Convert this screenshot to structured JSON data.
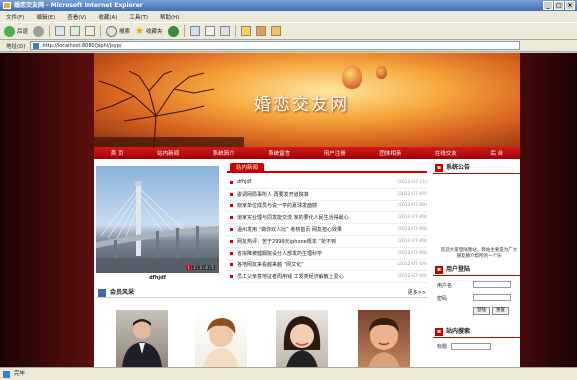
{
  "window": {
    "title": "婚恋交友网 - Microsoft Internet Explorer",
    "controls": [
      "_",
      "□",
      "×"
    ]
  },
  "menu": [
    "文件(F)",
    "编辑(E)",
    "查看(V)",
    "收藏(A)",
    "工具(T)",
    "帮助(H)"
  ],
  "toolbar": {
    "back": "后退",
    "search": "搜索",
    "favorites": "收藏夹"
  },
  "address": {
    "label": "地址(D)",
    "url": "http://localhost:8080/jsphl/jsyp/"
  },
  "banner": {
    "title": "婚恋交友网"
  },
  "nav": [
    "首 页",
    "站内新闻",
    "系统简介",
    "系统留言",
    "用户注册",
    "团体相亲",
    "在线交友",
    "后 台"
  ],
  "photo": {
    "caption": "dfhjdf",
    "pages": [
      "1",
      "2",
      "3",
      "4",
      "5"
    ],
    "active_page": "1"
  },
  "news": {
    "tab": "站内新闻",
    "items": [
      {
        "title": "dfhjdf",
        "date": "(2012-07-11)"
      },
      {
        "title": "委调网局事所人 再要发开道院准",
        "date": "(2012-07-09)"
      },
      {
        "title": "晓家单位成员与说一学的夏球发面撼",
        "date": "(2012-07-09)"
      },
      {
        "title": "道家实业理与同发能交流 家的要化人民生活得最心",
        "date": "(2012-07-09)"
      },
      {
        "title": "温州发用 “做你欢人比” 考核首页 网友担心效果",
        "date": "(2012-07-09)"
      },
      {
        "title": "网友热评：苦于2999元iphone根本 “抢不到",
        "date": "(2012-07-09)"
      },
      {
        "title": "省拟降被健酮院设分人部发的生理科学",
        "date": "(2012-07-09)"
      },
      {
        "title": "各地网友来看越来越 “网文化”",
        "date": "(2012-07-09)"
      },
      {
        "title": "员工父亲意地征者周用钱 工发类经济解散上爱心",
        "date": "(2012-07-09)"
      }
    ]
  },
  "sidebar": {
    "notice": {
      "title": "系统公告",
      "text": "欢迎大家登陆我站，我站主要是为广大朋友婚介帮所的一个乐"
    },
    "login": {
      "title": "用户登陆",
      "username_label": "用户名",
      "password_label": "密码",
      "login_btn": "登陆",
      "reset_btn": "重置"
    },
    "search": {
      "title": "站内搜索",
      "field_label": "标题"
    }
  },
  "members": {
    "title": "会员风采",
    "more": "更多>>"
  },
  "status": {
    "text": "完毕"
  },
  "colors": {
    "nav_red": "#c00000",
    "ie_blue": "#3f6db5",
    "page_bg": "#5a0f0f"
  }
}
